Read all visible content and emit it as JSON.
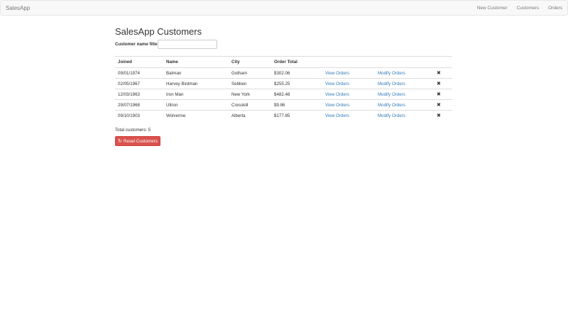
{
  "navbar": {
    "brand": "SalesApp",
    "links": [
      "New Customer",
      "Customers",
      "Orders"
    ]
  },
  "page": {
    "title": "SalesApp Customers"
  },
  "filter": {
    "label": "Customer name filter",
    "value": "",
    "placeholder": ""
  },
  "table": {
    "headers": [
      "Joined",
      "Name",
      "City",
      "Order Total"
    ],
    "view_orders_label": "View Orders",
    "modify_orders_label": "Modify Orders",
    "delete_icon": "✖",
    "rows": [
      {
        "joined": "09/01/1974",
        "name": "Batman",
        "city": "Gotham",
        "total": "$302.06"
      },
      {
        "joined": "02/05/1967",
        "name": "Harvey Birdman",
        "city": "Sebben",
        "total": "$255.25"
      },
      {
        "joined": "12/03/1963",
        "name": "Iron Man",
        "city": "New York",
        "total": "$482.48"
      },
      {
        "joined": "29/07/1968",
        "name": "Ultron",
        "city": "Cresskill",
        "total": "$9.86"
      },
      {
        "joined": "09/10/1903",
        "name": "Wolverine",
        "city": "Alberta",
        "total": "$177.85"
      }
    ]
  },
  "footer": {
    "total_customers": "Total customers: 5",
    "reset_label": "Reset Customers",
    "reset_icon": "refresh-icon"
  },
  "colors": {
    "link": "#337ab7",
    "danger": "#d9534f",
    "navbar_bg": "#f8f8f8"
  }
}
